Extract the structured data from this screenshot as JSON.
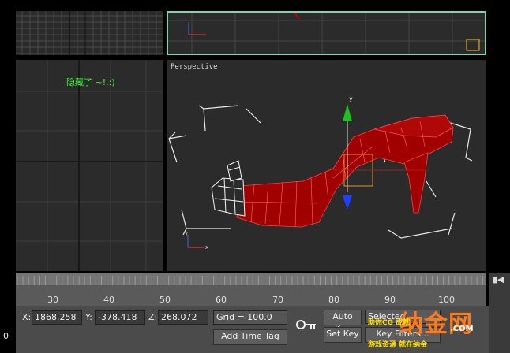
{
  "viewports": {
    "perspective_label": "Perspective",
    "left_note": "隐藏了 ~!.:)"
  },
  "timeline": {
    "ticks": [
      "30",
      "40",
      "50",
      "60",
      "70",
      "80",
      "90",
      "100"
    ]
  },
  "coords": {
    "x_label": "X:",
    "x_value": "1868.258",
    "y_label": "Y:",
    "y_value": "-378.418",
    "z_label": "Z:",
    "z_value": "268.072"
  },
  "grid_label": "Grid = 100.0",
  "add_time_tag": "Add Time Tag",
  "auto_key": "Auto Key",
  "set_key": "Set Key",
  "selected": "Selected",
  "key_filters": "Key Filters...",
  "left_edge_char": "0",
  "watermark": {
    "brand": "纳金网",
    "sub1": "助你CG 成就",
    "sub2": "游戏资源 就在纳金",
    "url": ".COM"
  },
  "colors": {
    "viewport_bg": "#2b2b2b",
    "active_border": "#7fd3b8",
    "model_red": "#a00000",
    "note_green": "#3cff3c",
    "watermark_orange": "#ff7a1a"
  }
}
